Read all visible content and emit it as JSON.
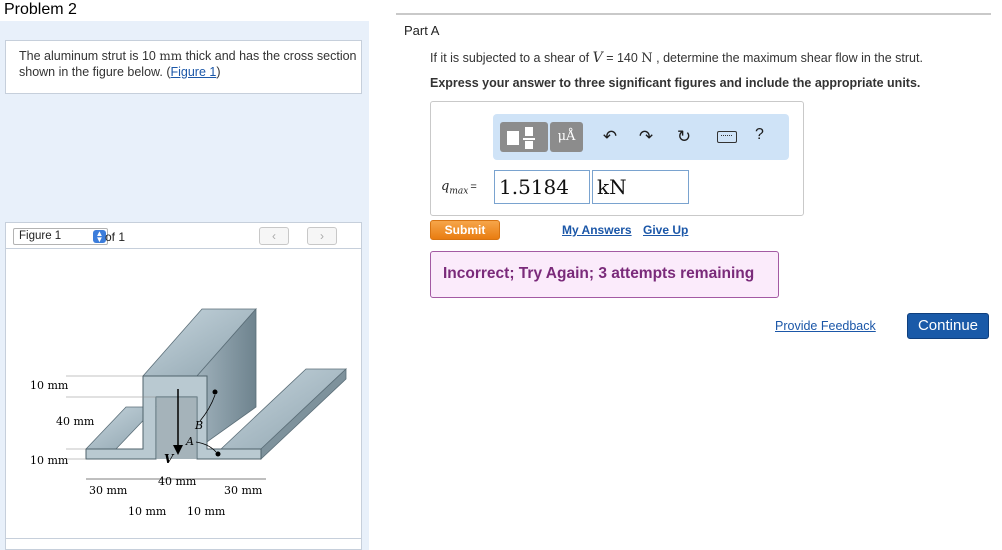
{
  "problem": {
    "title": "Problem 2",
    "intro_before": "The aluminum strut is 10 ",
    "intro_mm": "mm",
    "intro_after": " thick and has the cross section shown in the figure below. (",
    "figure_link": "Figure 1",
    "intro_close": ")"
  },
  "figure_nav": {
    "selected": "Figure 1",
    "of_label": "of 1",
    "prev_icon": "chevron-left-icon",
    "next_icon": "chevron-right-icon"
  },
  "figure": {
    "labels": {
      "top_thickness": "10 mm",
      "height": "40 mm",
      "bottom_thickness": "10 mm",
      "left_flange": "30 mm",
      "web_gap": "40 mm",
      "right_flange": "30 mm",
      "left_web": "10 mm",
      "right_web": "10 mm",
      "point_a": "A",
      "point_b": "B",
      "shear": "V"
    }
  },
  "part": {
    "title": "Part A",
    "question_prefix": "If it is subjected to a shear of ",
    "question_var": "V",
    "question_eq": " = 140 ",
    "question_unit": "N",
    "question_suffix": " , determine the maximum shear flow in the strut.",
    "instruction": "Express your answer to three significant figures and include the appropriate units."
  },
  "toolbar": {
    "templates_icon": "templates-icon",
    "units_label": "μÅ",
    "undo_icon": "undo-icon",
    "redo_icon": "redo-icon",
    "reset_icon": "reset-icon",
    "keyboard_icon": "keyboard-icon",
    "help_label": "?"
  },
  "answer": {
    "var_main": "q",
    "var_sub": "max",
    "equals": "=",
    "value": "1.5184",
    "unit": "kN"
  },
  "actions": {
    "submit": "Submit",
    "my_answers": "My Answers",
    "give_up": "Give Up"
  },
  "feedback": {
    "message": "Incorrect; Try Again; 3 attempts remaining"
  },
  "footer": {
    "provide_feedback": "Provide Feedback",
    "continue": "Continue"
  },
  "colors": {
    "accent_blue": "#1a5aa8",
    "submit_orange": "#ee8a22",
    "feedback_bg": "#fbebfb",
    "feedback_text": "#7a2a7a",
    "panel_bg": "#e8f0fa"
  }
}
